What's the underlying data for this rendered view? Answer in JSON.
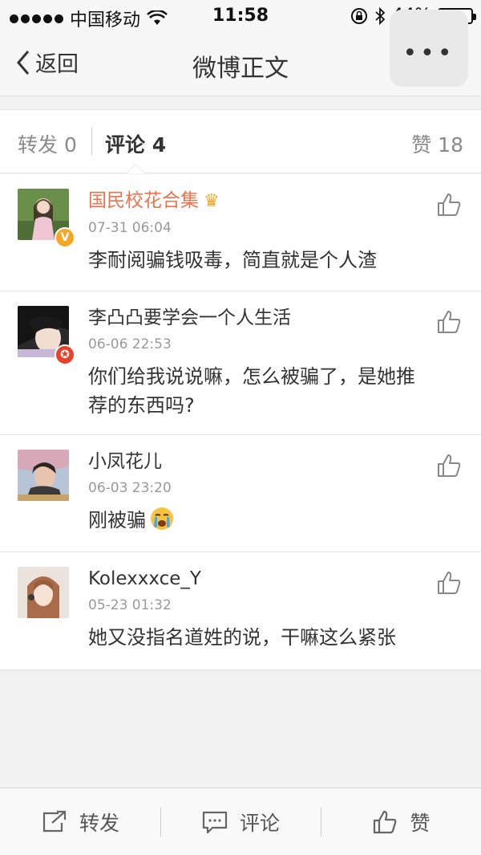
{
  "status": {
    "carrier": "中国移动",
    "time": "11:58",
    "battery": "44%",
    "battery_level": 0.44
  },
  "nav": {
    "back_label": "返回",
    "title": "微博正文",
    "more_label": "•••"
  },
  "tabs": {
    "repost": "转发 0",
    "comment": "评论 4",
    "like": "赞 18"
  },
  "comments": [
    {
      "name": "国民校花合集",
      "time": "07-31 06:04",
      "text": "李耐阅骗钱吸毒，简直就是个人渣",
      "badge": "V",
      "badge_color": "#f5a623",
      "vip": true
    },
    {
      "name": "李凸凸要学会一个人生活",
      "time": "06-06 22:53",
      "text": "你们给我说说嘛，怎么被骗了，是她推荐的东西吗?",
      "badge": "✪",
      "badge_color": "#e8412c",
      "vip": false
    },
    {
      "name": "小凤花儿",
      "time": "06-03 23:20",
      "text": "刚被骗",
      "emoji": "crying-face",
      "vip": false
    },
    {
      "name": "Kolexxxce_Y",
      "time": "05-23 01:32",
      "text": "她又没指名道姓的说，干嘛这么紧张",
      "vip": false
    }
  ],
  "bottom": {
    "repost": "转发",
    "comment": "评论",
    "like": "赞"
  },
  "colors": {
    "accent": "#eb7350",
    "vip_badge": "#f5a623",
    "red_badge": "#e8412c"
  }
}
